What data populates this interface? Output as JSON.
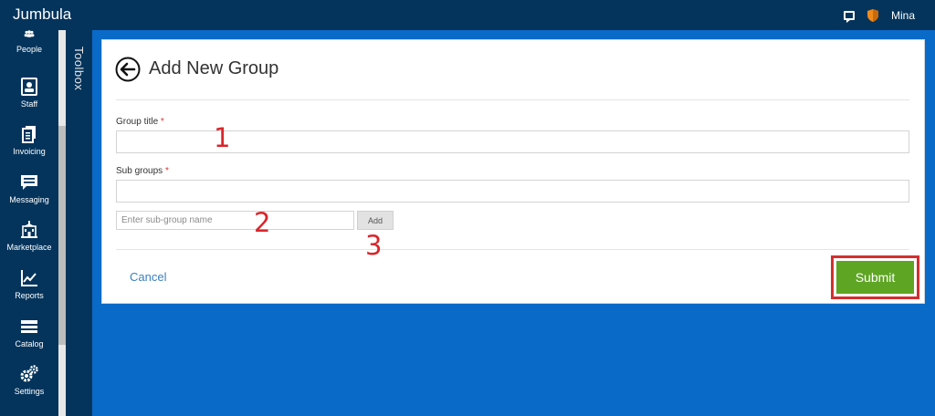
{
  "app": {
    "brand": "Jumbula"
  },
  "topbar": {
    "user_name": "Mina",
    "icons": [
      "chat-icon",
      "shield-icon"
    ]
  },
  "sidebar": {
    "items": [
      {
        "label": "People",
        "icon": "people-icon"
      },
      {
        "label": "Staff",
        "icon": "staff-icon"
      },
      {
        "label": "Invoicing",
        "icon": "invoice-icon"
      },
      {
        "label": "Messaging",
        "icon": "message-icon"
      },
      {
        "label": "Marketplace",
        "icon": "marketplace-icon"
      },
      {
        "label": "Reports",
        "icon": "reports-icon"
      },
      {
        "label": "Catalog",
        "icon": "catalog-icon"
      },
      {
        "label": "Settings",
        "icon": "settings-icon"
      }
    ]
  },
  "toolbox": {
    "label": "Toolbox"
  },
  "form": {
    "title": "Add New Group",
    "group_title_label": "Group title",
    "group_title_value": "",
    "sub_groups_label": "Sub groups",
    "sub_groups_value": "",
    "required_mark": "*",
    "subgroup_placeholder": "Enter sub-group name",
    "add_label": "Add",
    "cancel_label": "Cancel",
    "submit_label": "Submit"
  },
  "annotations": {
    "one": "1",
    "two": "2",
    "three": "3"
  },
  "colors": {
    "topbar": "#04345c",
    "background": "#0a6ac8",
    "submit": "#5ea524",
    "highlight": "#d32f2f",
    "link": "#3a7fc1"
  }
}
